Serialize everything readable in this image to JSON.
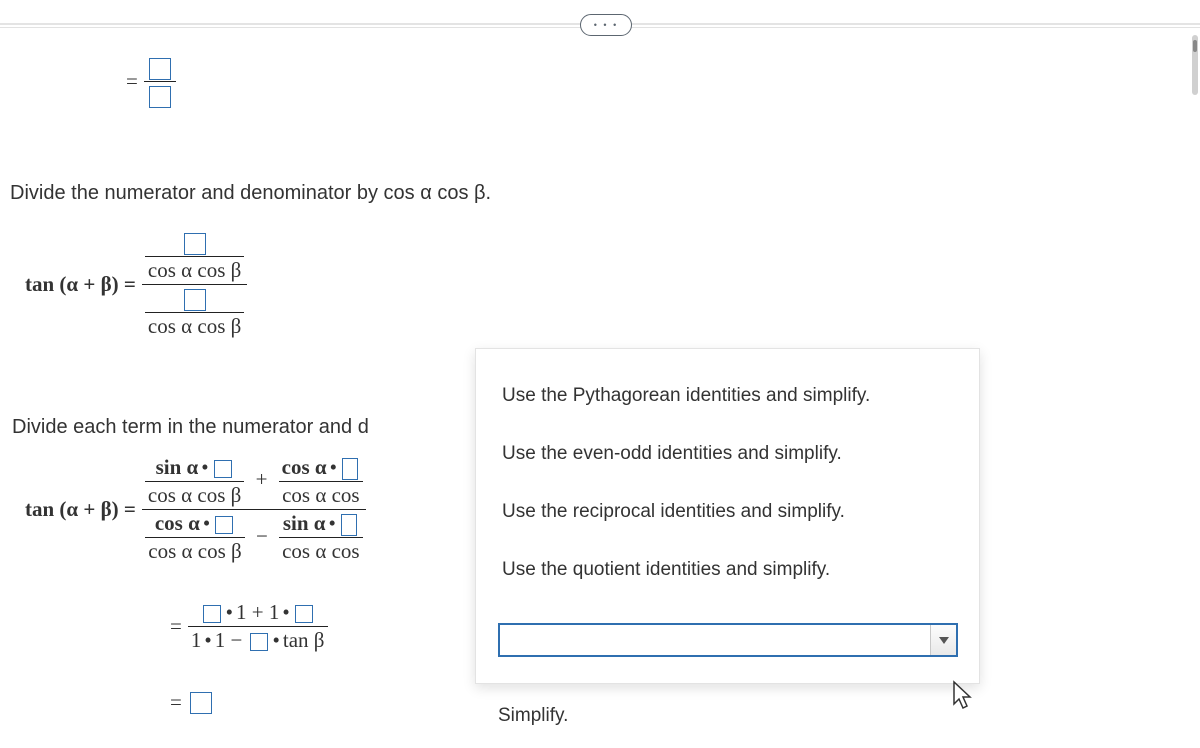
{
  "row1": {
    "eq": "="
  },
  "instr1": "Divide the numerator and denominator by cos α cos β.",
  "row2": {
    "lhs": "tan (α + β) =",
    "top_denom": "cos α cos β",
    "bot_denom": "cos α cos β"
  },
  "instr2": "Divide each term in the numerator and d",
  "row3": {
    "lhs": "tan (α + β) =",
    "t1_num_pre": "sin α",
    "t1_den": "cos α cos β",
    "plus": "+",
    "t2_num_pre": "cos α",
    "t2_den": "cos α cos",
    "b1_num_pre": "cos α",
    "b1_den": "cos α cos β",
    "minus": "−",
    "b2_num_pre": "sin α",
    "b2_den": "cos α cos"
  },
  "row4": {
    "eq": "=",
    "num_mid": "1 + 1",
    "den_pre": "1",
    "den_mid": "1 −",
    "den_post": "tan β"
  },
  "row5": {
    "eq": "="
  },
  "panel": {
    "opts": [
      "Use the Pythagorean identities and simplify.",
      "Use the even-odd identities and simplify.",
      "Use the reciprocal identities and simplify.",
      "Use the quotient identities and simplify."
    ]
  },
  "simplify": "Simplify.",
  "mul": "•"
}
